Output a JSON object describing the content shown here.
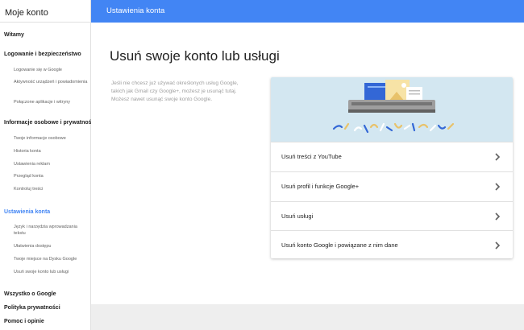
{
  "sidebar": {
    "title": "Moje konto",
    "welcome": "Witamy",
    "security": {
      "title": "Logowanie i bezpieczeństwo",
      "items": [
        "Logowanie się w Google",
        "Aktywność urządzeń i powiadomienia",
        "Połączone aplikacje i witryny"
      ]
    },
    "privacy": {
      "title": "Informacje osobowe i prywatność",
      "items": [
        "Twoje informacje osobowe",
        "Historia konta",
        "Ustawienia reklam",
        "Przegląd konta",
        "Kontroluj treści"
      ]
    },
    "prefs": {
      "title": "Ustawienia konta",
      "items": [
        "Język i narzędzia wprowadzania tekstu",
        "Ułatwienia dostępu",
        "Twoje miejsce na Dysku Google",
        "Usuń swoje konto lub usługi"
      ]
    },
    "about": "Wszystko o Google",
    "policy": "Polityka prywatności",
    "help": "Pomoc i opinie"
  },
  "topbar": {
    "title": "Ustawienia konta"
  },
  "main": {
    "title": "Usuń swoje konto lub usługi",
    "description": "Jeśli nie chcesz już używać określonych usług Google, takich jak Gmail czy Google+, możesz je usunąć tutaj. Możesz nawet usunąć swoje konto Google.",
    "options": [
      "Usuń treści z YouTube",
      "Usuń profil i funkcje Google+",
      "Usuń usługi",
      "Usuń konto Google i powiązane z nim dane"
    ]
  },
  "colors": {
    "accent": "#4285f4",
    "illustration_bg": "#d3e7f1"
  }
}
